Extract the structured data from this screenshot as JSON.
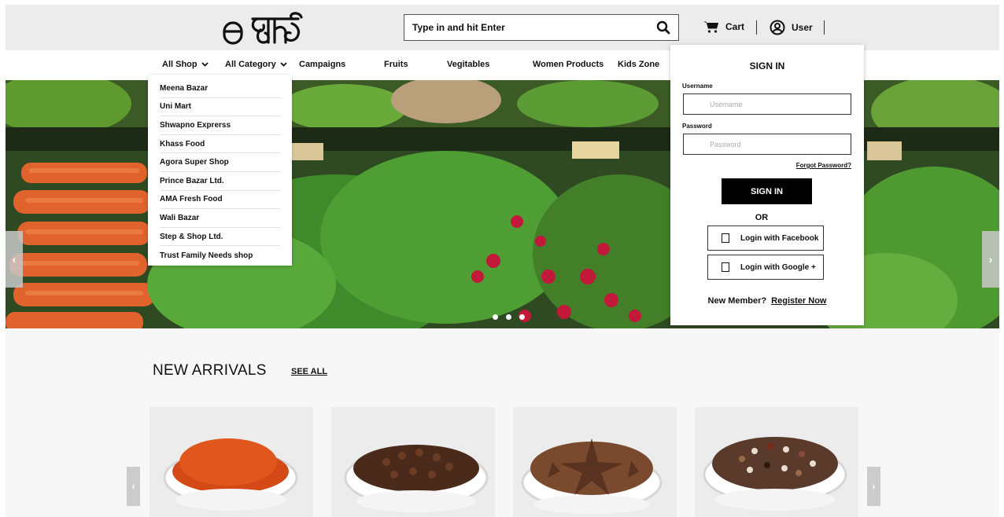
{
  "header": {
    "search_placeholder": "Type in and hit Enter",
    "cart_label": "Cart",
    "user_label": "User"
  },
  "nav": {
    "items": [
      "All Shop",
      "All Category",
      "Campaigns",
      "Fruits",
      "Vegitables",
      "Women Products",
      "Kids Zone"
    ]
  },
  "shop_dropdown": {
    "items": [
      "Meena Bazar",
      "Uni Mart",
      "Shwapno Exprerss",
      "Khass Food",
      "Agora Super Shop",
      "Prince Bazar Ltd.",
      "AMA Fresh Food",
      "Wali Bazar",
      "Step & Shop Ltd.",
      "Trust Family Needs shop"
    ]
  },
  "signin": {
    "title": "SIGN IN",
    "username_label": "Username",
    "username_placeholder": "Username",
    "password_label": "Password",
    "password_placeholder": "Password",
    "forgot": "Forgot Password?",
    "button": "SIGN IN",
    "or": "OR",
    "facebook": "Login with Facebook",
    "google": "Login with Google +",
    "new_member": "New Member?",
    "register": "Register Now"
  },
  "hero": {
    "prev": "‹",
    "next": "›"
  },
  "arrivals": {
    "title": "NEW ARRIVALS",
    "see_all": "SEE ALL",
    "prev": "‹",
    "next": "›"
  },
  "colors": {
    "header_bg": "#ececec",
    "button_bg": "#000000"
  }
}
